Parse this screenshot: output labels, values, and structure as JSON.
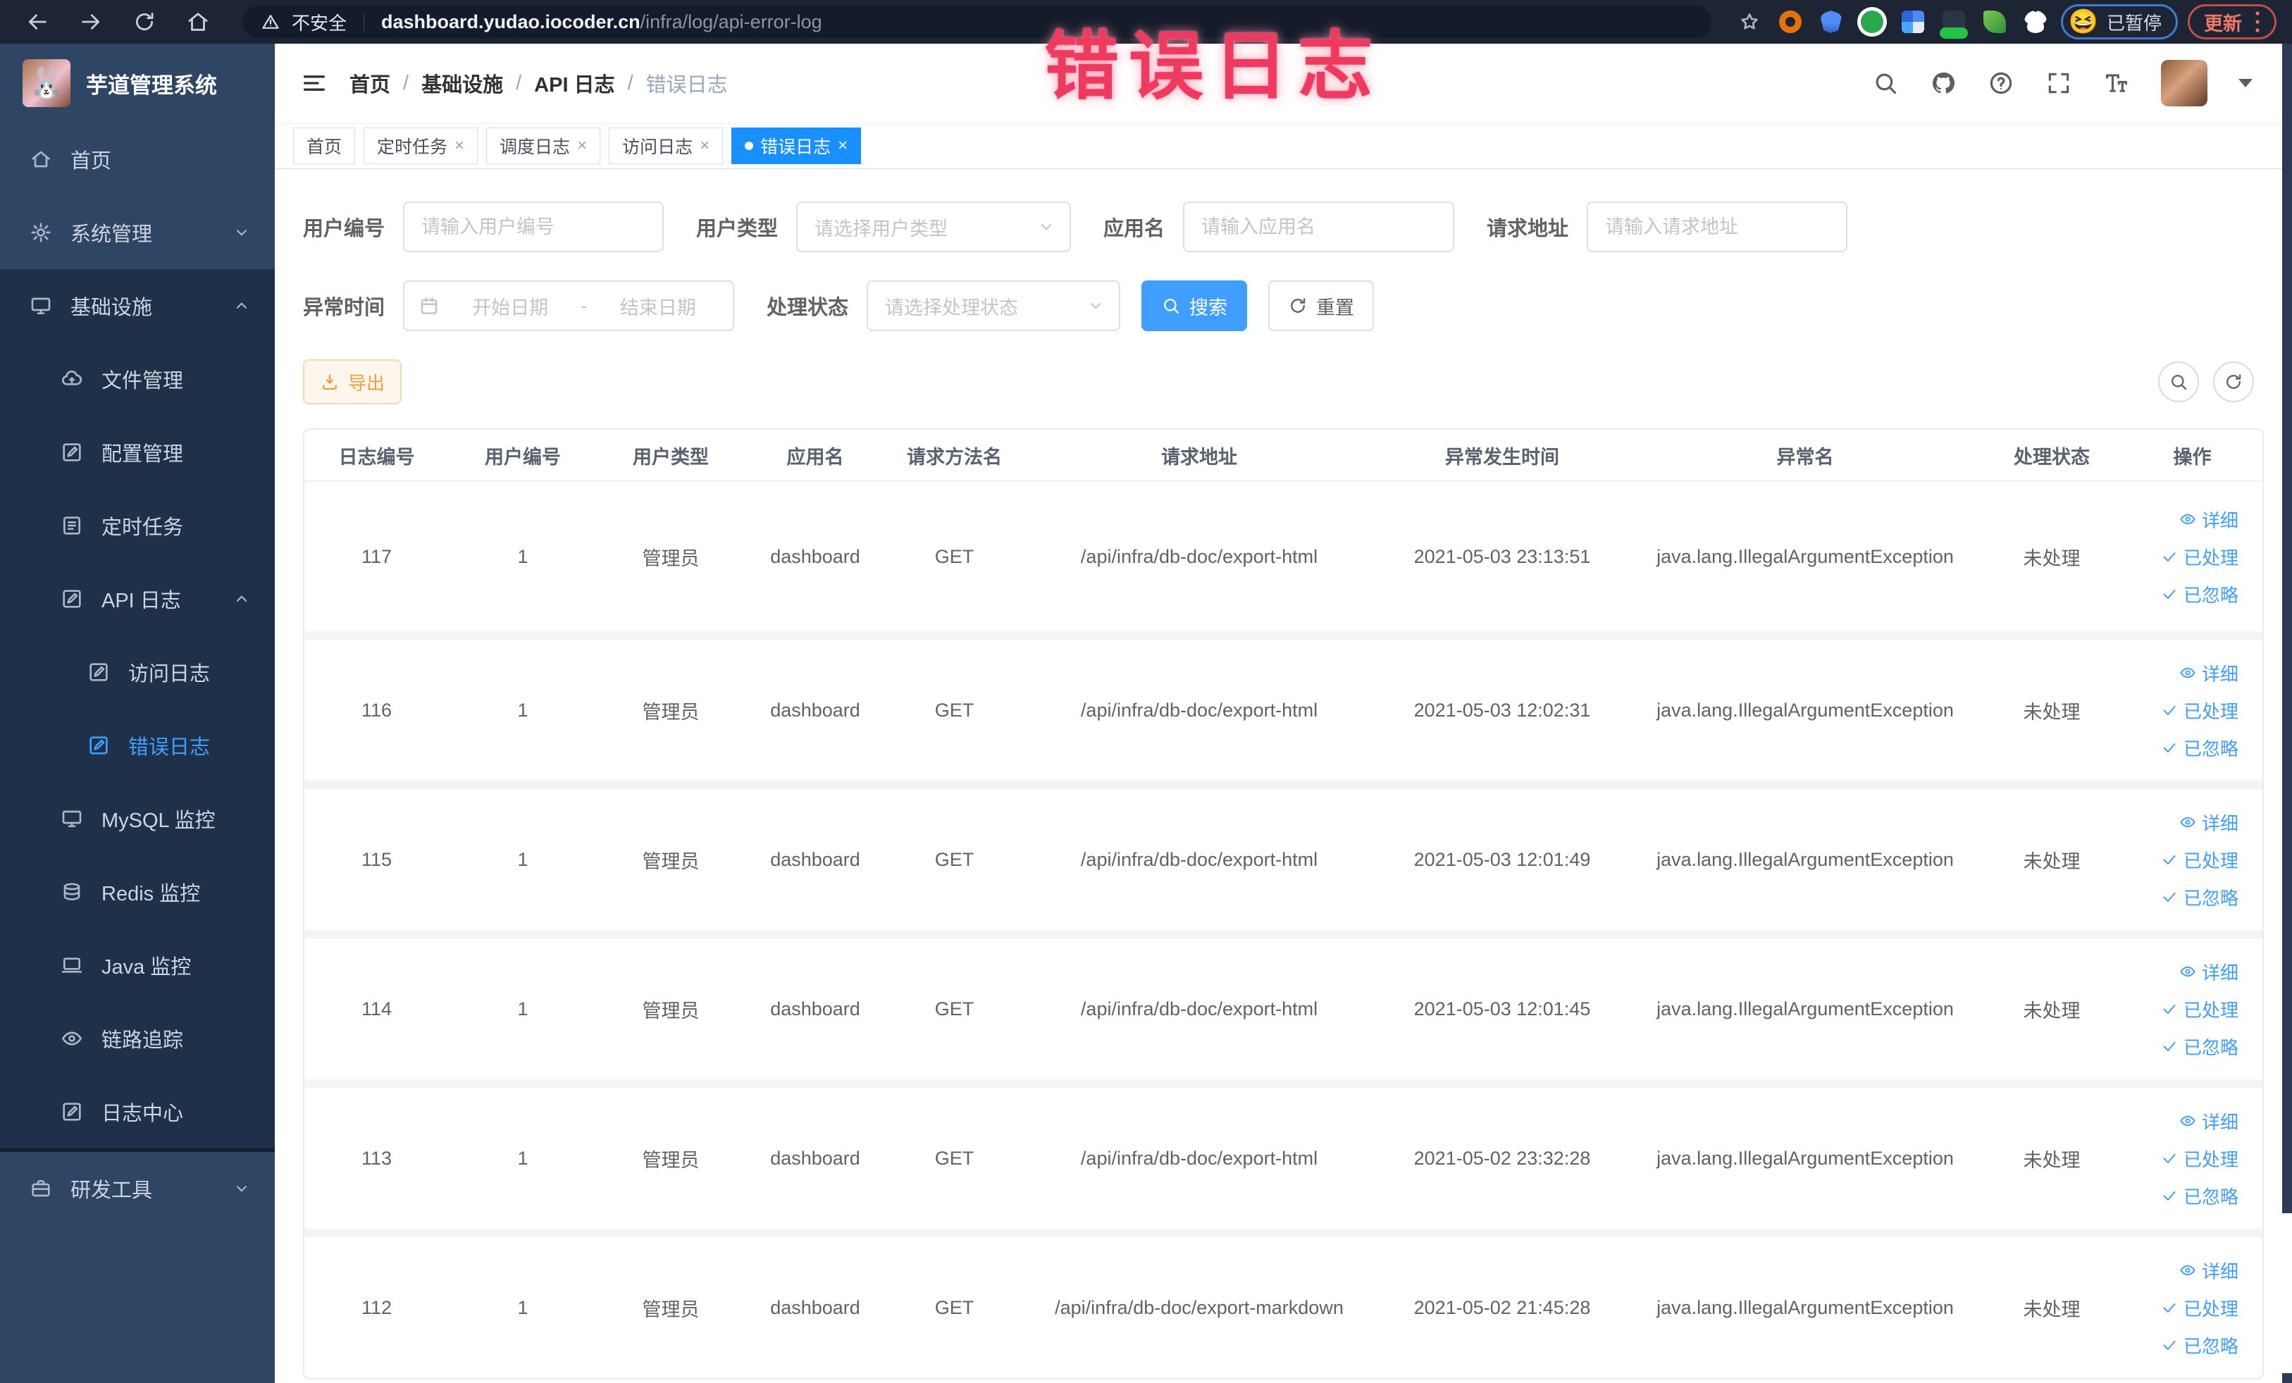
{
  "browser": {
    "security_label": "不安全",
    "url_host": "dashboard.yudao.iocoder.cn",
    "url_path": "/infra/log/api-error-log",
    "paused_label": "已暂停",
    "paused_emoji": "😆",
    "update_label": "更新"
  },
  "annotation": "错误日志",
  "sidebar": {
    "title": "芋道管理系统",
    "logo_emoji": "🐰",
    "items": [
      {
        "name": "home",
        "label": "首页",
        "icon": "home-icon",
        "level": 1,
        "section": "top"
      },
      {
        "name": "system-manage",
        "label": "系统管理",
        "icon": "gear-icon",
        "level": 1,
        "arrow": "down",
        "section": "top"
      },
      {
        "name": "infrastructure",
        "label": "基础设施",
        "icon": "infra-icon",
        "level": 1,
        "arrow": "up",
        "section": "dark"
      },
      {
        "name": "file-manage",
        "label": "文件管理",
        "icon": "cloud-upload-icon",
        "level": 2,
        "section": "dark"
      },
      {
        "name": "config-manage",
        "label": "配置管理",
        "icon": "edit-square-icon",
        "level": 2,
        "section": "dark"
      },
      {
        "name": "scheduled-task",
        "label": "定时任务",
        "icon": "todo-icon",
        "level": 2,
        "section": "dark"
      },
      {
        "name": "api-log",
        "label": "API 日志",
        "icon": "edit-square-icon",
        "level": 2,
        "arrow": "up",
        "section": "dark"
      },
      {
        "name": "access-log",
        "label": "访问日志",
        "icon": "edit-square-icon",
        "level": 3,
        "section": "dark"
      },
      {
        "name": "error-log",
        "label": "错误日志",
        "icon": "edit-square-icon",
        "level": 3,
        "section": "dark",
        "active": true
      },
      {
        "name": "mysql-monitor",
        "label": "MySQL 监控",
        "icon": "monitor-icon",
        "level": 2,
        "section": "dark"
      },
      {
        "name": "redis-monitor",
        "label": "Redis 监控",
        "icon": "layers-icon",
        "level": 2,
        "section": "dark"
      },
      {
        "name": "java-monitor",
        "label": "Java 监控",
        "icon": "laptop-icon",
        "level": 2,
        "section": "dark"
      },
      {
        "name": "trace",
        "label": "链路追踪",
        "icon": "eye-icon",
        "level": 2,
        "section": "dark"
      },
      {
        "name": "log-center",
        "label": "日志中心",
        "icon": "edit-square-icon",
        "level": 2,
        "section": "dark",
        "divider_after": true
      },
      {
        "name": "dev-tools",
        "label": "研发工具",
        "icon": "toolbox-icon",
        "level": 1,
        "arrow": "down",
        "section": "top"
      }
    ]
  },
  "breadcrumb": {
    "separator": "/",
    "items": [
      "首页",
      "基础设施",
      "API 日志",
      "错误日志"
    ]
  },
  "tabbar": {
    "close_glyph": "×",
    "tabs": [
      {
        "name": "home",
        "label": "首页",
        "closable": false,
        "active": false
      },
      {
        "name": "scheduled-task",
        "label": "定时任务",
        "closable": true,
        "active": false
      },
      {
        "name": "schedule-log",
        "label": "调度日志",
        "closable": true,
        "active": false
      },
      {
        "name": "access-log",
        "label": "访问日志",
        "closable": true,
        "active": false
      },
      {
        "name": "error-log",
        "label": "错误日志",
        "closable": true,
        "active": true
      }
    ]
  },
  "filters": {
    "user_id": {
      "label": "用户编号",
      "placeholder": "请输入用户编号"
    },
    "user_type": {
      "label": "用户类型",
      "placeholder": "请选择用户类型"
    },
    "app_name": {
      "label": "应用名",
      "placeholder": "请输入应用名"
    },
    "request_url": {
      "label": "请求地址",
      "placeholder": "请输入请求地址"
    },
    "exception_time": {
      "label": "异常时间",
      "start_placeholder": "开始日期",
      "separator": "-",
      "end_placeholder": "结束日期"
    },
    "process_status": {
      "label": "处理状态",
      "placeholder": "请选择处理状态"
    },
    "search_label": "搜索",
    "reset_label": "重置"
  },
  "toolbar": {
    "export_label": "导出"
  },
  "table": {
    "headers": [
      "日志编号",
      "用户编号",
      "用户类型",
      "应用名",
      "请求方法名",
      "请求地址",
      "异常发生时间",
      "异常名",
      "处理状态",
      "操作"
    ],
    "actions": [
      {
        "name": "detail",
        "label": "详细",
        "icon": "eye-icon"
      },
      {
        "name": "mark-processed",
        "label": "已处理",
        "icon": "check-icon"
      },
      {
        "name": "mark-ignored",
        "label": "已忽略",
        "icon": "check-icon"
      }
    ],
    "rows": [
      {
        "id": "117",
        "user_id": "1",
        "user_type": "管理员",
        "app": "dashboard",
        "method": "GET",
        "url": "/api/infra/db-doc/export-html",
        "time": "2021-05-03 23:13:51",
        "exception": "java.lang.IllegalArgumentException",
        "status": "未处理"
      },
      {
        "id": "116",
        "user_id": "1",
        "user_type": "管理员",
        "app": "dashboard",
        "method": "GET",
        "url": "/api/infra/db-doc/export-html",
        "time": "2021-05-03 12:02:31",
        "exception": "java.lang.IllegalArgumentException",
        "status": "未处理"
      },
      {
        "id": "115",
        "user_id": "1",
        "user_type": "管理员",
        "app": "dashboard",
        "method": "GET",
        "url": "/api/infra/db-doc/export-html",
        "time": "2021-05-03 12:01:49",
        "exception": "java.lang.IllegalArgumentException",
        "status": "未处理"
      },
      {
        "id": "114",
        "user_id": "1",
        "user_type": "管理员",
        "app": "dashboard",
        "method": "GET",
        "url": "/api/infra/db-doc/export-html",
        "time": "2021-05-03 12:01:45",
        "exception": "java.lang.IllegalArgumentException",
        "status": "未处理"
      },
      {
        "id": "113",
        "user_id": "1",
        "user_type": "管理员",
        "app": "dashboard",
        "method": "GET",
        "url": "/api/infra/db-doc/export-html",
        "time": "2021-05-02 23:32:28",
        "exception": "java.lang.IllegalArgumentException",
        "status": "未处理"
      },
      {
        "id": "112",
        "user_id": "1",
        "user_type": "管理员",
        "app": "dashboard",
        "method": "GET",
        "url": "/api/infra/db-doc/export-markdown",
        "time": "2021-05-02 21:45:28",
        "exception": "java.lang.IllegalArgumentException",
        "status": "未处理"
      }
    ]
  },
  "colors": {
    "accent": "#409eff",
    "tag_active": "#1890ff",
    "warn_text": "#e6a23c",
    "annotation": "#ee3a5f",
    "sidebar_bg": "#2e4563",
    "sidebar_submenu_bg": "#1f3148"
  }
}
